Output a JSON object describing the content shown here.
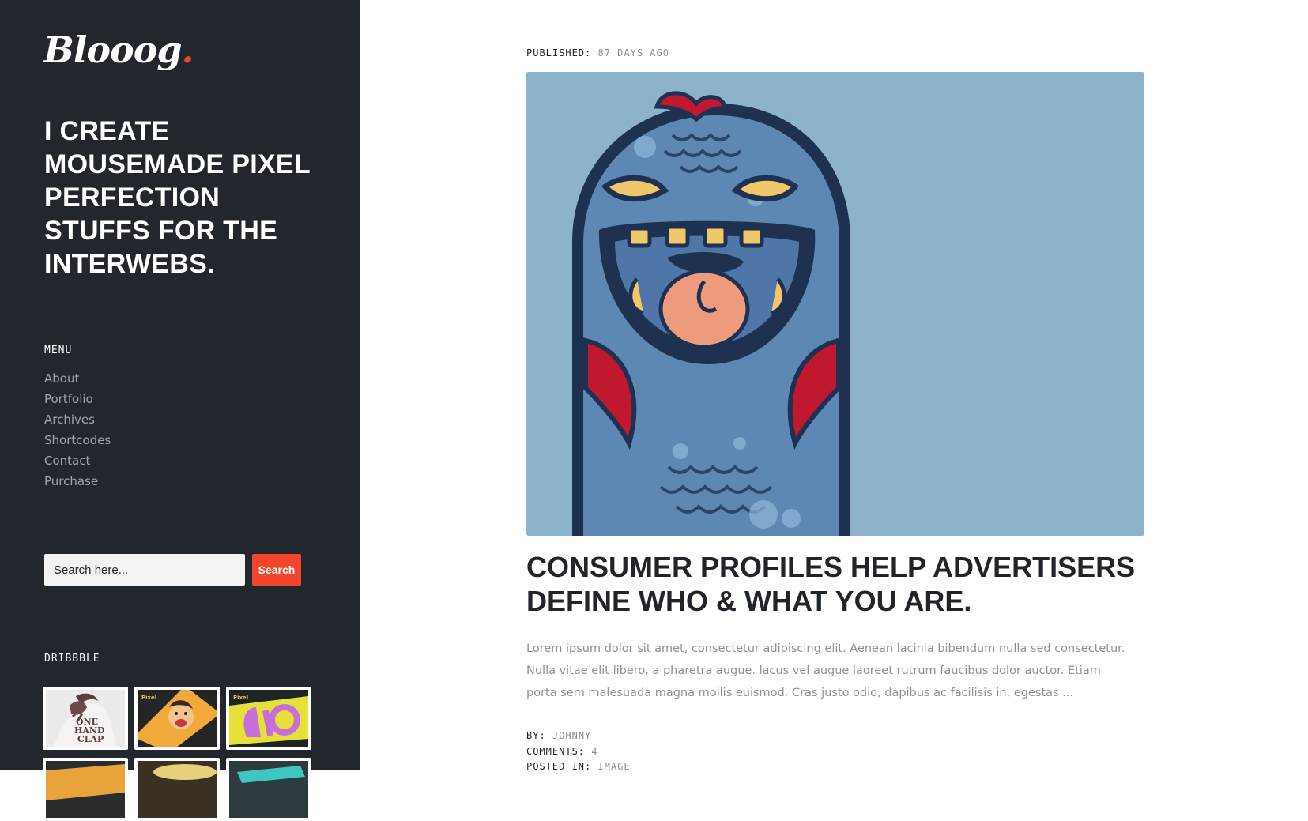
{
  "sidebar": {
    "logo": {
      "text": "Blooog",
      "dot": "."
    },
    "tagline": "I create mousemade pixel perfection stuffs for the interwebs.",
    "menu_title": "MENU",
    "menu": [
      "About",
      "Portfolio",
      "Archives",
      "Shortcodes",
      "Contact",
      "Purchase"
    ],
    "search": {
      "placeholder": "Search here...",
      "button": "Search"
    },
    "dribbble_title": "DRIBBBLE",
    "shots": [
      {
        "icon": "one-hand-clap-thumb"
      },
      {
        "icon": "cartoon-face-thumb"
      },
      {
        "icon": "purple-monster-thumb"
      },
      {
        "icon": "shot-thumb"
      },
      {
        "icon": "shot-thumb"
      },
      {
        "icon": "shot-thumb"
      }
    ]
  },
  "post": {
    "published_label": "PUBLISHED:",
    "published_value": "87 DAYS AGO",
    "title": "Consumer profiles help advertisers define who & what you are.",
    "excerpt": "Lorem ipsum dolor sit amet, consectetur adipiscing elit. Aenean lacinia bibendum nulla sed consectetur. Nulla vitae elit libero, a pharetra augue. lacus vel augue laoreet rutrum faucibus dolor auctor. Etiam porta sem malesuada magna mollis euismod. Cras justo odio, dapibus ac facilisis in, egestas ...",
    "by_label": "BY:",
    "by_value": "JOHNNY",
    "comments_label": "COMMENTS:",
    "comments_value": "4",
    "posted_label": "POSTED IN:",
    "posted_value": "IMAGE",
    "image_icon": "blue-monster-illustration"
  },
  "colors": {
    "sidebar_bg": "#22272e",
    "accent": "#f1452c",
    "image_bg": "#8db3cb",
    "title": "#20252b",
    "muted": "#8c9196"
  }
}
